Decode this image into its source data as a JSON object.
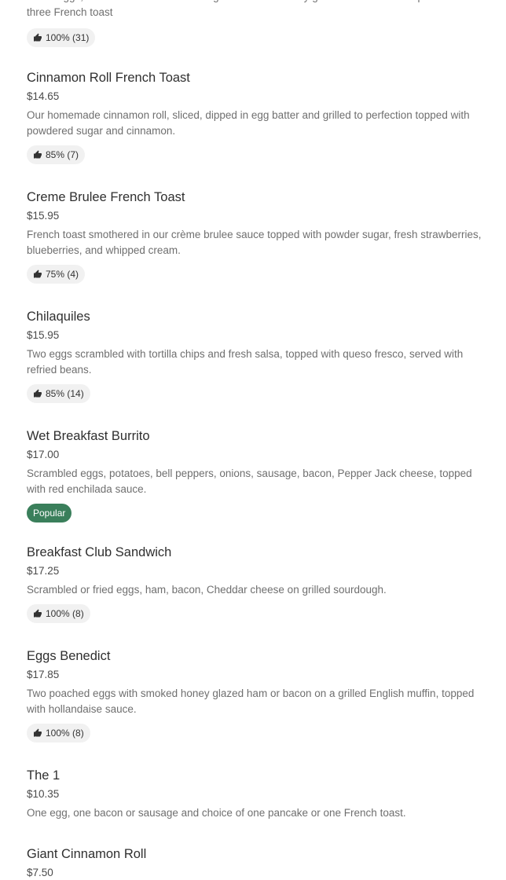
{
  "items": [
    {
      "name": "",
      "price": "",
      "desc": "Three eggs, three bacon or three sausage or smoked honey glazed ham and three pancakes or three French toast",
      "badge": "100% (31)",
      "popular": false
    },
    {
      "name": "Cinnamon Roll French Toast",
      "price": "$14.65",
      "desc": "Our homemade cinnamon roll, sliced, dipped in egg batter and grilled to perfection topped with powdered sugar and cinnamon.",
      "badge": "85% (7)",
      "popular": false
    },
    {
      "name": "Creme Brulee French Toast",
      "price": "$15.95",
      "desc": "French toast smothered in our crème brulee sauce topped with powder sugar, fresh strawberries, blueberries, and whipped cream.",
      "badge": "75% (4)",
      "popular": false
    },
    {
      "name": "Chilaquiles",
      "price": "$15.95",
      "desc": "Two eggs scrambled with tortilla chips and fresh salsa, topped with queso fresco, served with refried beans.",
      "badge": "85% (14)",
      "popular": false
    },
    {
      "name": "Wet Breakfast Burrito",
      "price": "$17.00",
      "desc": "Scrambled eggs, potatoes, bell peppers, onions, sausage, bacon, Pepper Jack cheese, topped with red enchilada sauce.",
      "badge": "Popular",
      "popular": true
    },
    {
      "name": "Breakfast Club Sandwich",
      "price": "$17.25",
      "desc": "Scrambled or fried eggs, ham, bacon, Cheddar cheese on grilled sourdough.",
      "badge": "100% (8)",
      "popular": false
    },
    {
      "name": "Eggs Benedict",
      "price": "$17.85",
      "desc": "Two poached eggs with smoked honey glazed ham or bacon on a grilled English muffin, topped with hollandaise sauce.",
      "badge": "100% (8)",
      "popular": false
    },
    {
      "name": "The 1",
      "price": "$10.35",
      "desc": "One egg, one bacon or sausage and choice of one pancake or one French toast.",
      "badge": "",
      "popular": false
    },
    {
      "name": "Giant Cinnamon Roll",
      "price": "$7.50",
      "desc": "",
      "badge": "",
      "popular": false
    }
  ]
}
